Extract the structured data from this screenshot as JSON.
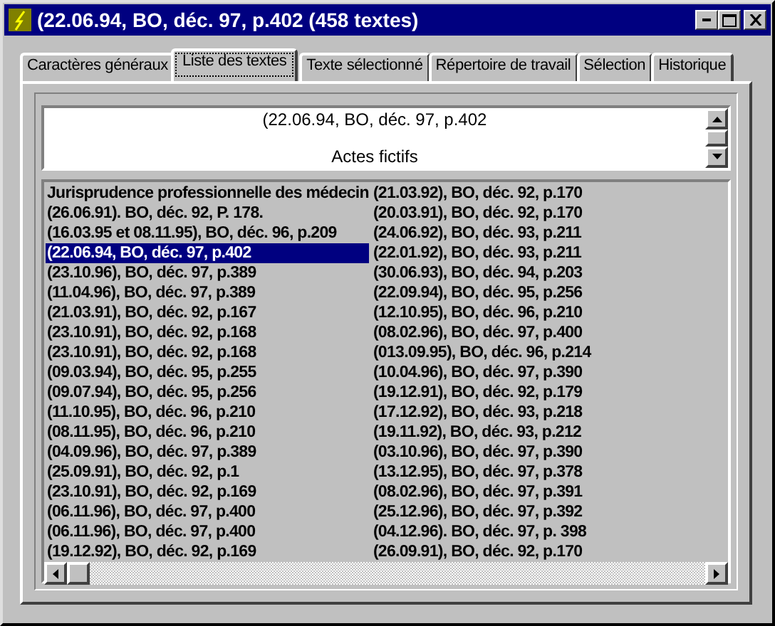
{
  "window": {
    "title": "(22.06.94, BO, déc. 97, p.402 (458 textes)"
  },
  "tabs": [
    {
      "label": "Caractères généraux",
      "selected": false
    },
    {
      "label": "Liste des textes",
      "selected": true
    },
    {
      "label": "Texte sélectionné",
      "selected": false
    },
    {
      "label": "Répertoire de travail",
      "selected": false
    },
    {
      "label": "Sélection",
      "selected": false
    },
    {
      "label": "Historique",
      "selected": false
    }
  ],
  "preview": {
    "lines": [
      "(22.06.94, BO, déc. 97, p.402",
      "Actes fictifs"
    ]
  },
  "list": {
    "items": [
      {
        "text": "Jurisprudence professionnelle des médecin",
        "selected": false
      },
      {
        "text": "(26.06.91). BO, déc. 92, P. 178.",
        "selected": false
      },
      {
        "text": "(16.03.95 et 08.11.95), BO, déc. 96, p.209",
        "selected": false
      },
      {
        "text": "(22.06.94, BO, déc. 97, p.402",
        "selected": true
      },
      {
        "text": "(23.10.96), BO, déc. 97, p.389",
        "selected": false
      },
      {
        "text": "(11.04.96), BO, déc. 97, p.389",
        "selected": false
      },
      {
        "text": "(21.03.91), BO, déc. 92, p.167",
        "selected": false
      },
      {
        "text": "(23.10.91), BO, déc. 92, p.168",
        "selected": false
      },
      {
        "text": "(23.10.91), BO, déc. 92, p.168",
        "selected": false
      },
      {
        "text": "(09.03.94), BO, déc. 95, p.255",
        "selected": false
      },
      {
        "text": "(09.07.94), BO, déc. 95, p.256",
        "selected": false
      },
      {
        "text": "(11.10.95), BO, déc. 96, p.210",
        "selected": false
      },
      {
        "text": "(08.11.95), BO, déc. 96, p.210",
        "selected": false
      },
      {
        "text": "(04.09.96), BO, déc. 97, p.389",
        "selected": false
      },
      {
        "text": "(25.09.91), BO, déc. 92, p.1",
        "selected": false
      },
      {
        "text": "(23.10.91), BO, déc. 92, p.169",
        "selected": false
      },
      {
        "text": "(06.11.96), BO, déc. 97, p.400",
        "selected": false
      },
      {
        "text": "(06.11.96), BO, déc. 97, p.400",
        "selected": false
      },
      {
        "text": "(19.12.92), BO, déc. 92, p.169",
        "selected": false
      },
      {
        "text": "(21.03.92), BO, déc. 92, p.170",
        "selected": false
      },
      {
        "text": "(20.03.91), BO, déc. 92, p.170",
        "selected": false
      },
      {
        "text": "(24.06.92), BO, déc. 93, p.211",
        "selected": false
      },
      {
        "text": "(22.01.92), BO, déc. 93, p.211",
        "selected": false
      },
      {
        "text": "(30.06.93), BO, déc. 94, p.203",
        "selected": false
      },
      {
        "text": "(22.09.94), BO, déc. 95, p.256",
        "selected": false
      },
      {
        "text": "(12.10.95), BO, déc. 96, p.210",
        "selected": false
      },
      {
        "text": "(08.02.96), BO, déc. 97, p.400",
        "selected": false
      },
      {
        "text": "(013.09.95), BO, déc. 96, p.214",
        "selected": false
      },
      {
        "text": "(10.04.96), BO, déc. 97, p.390",
        "selected": false
      },
      {
        "text": "(19.12.91), BO, déc. 92, p.179",
        "selected": false
      },
      {
        "text": "(17.12.92), BO, déc. 93, p.218",
        "selected": false
      },
      {
        "text": "(19.11.92), BO, déc. 93, p.212",
        "selected": false
      },
      {
        "text": "(03.10.96), BO, déc. 97, p.390",
        "selected": false
      },
      {
        "text": "(13.12.95), BO, déc. 97, p.378",
        "selected": false
      },
      {
        "text": "(08.02.96), BO, déc. 97, p.391",
        "selected": false
      },
      {
        "text": "(25.12.96), BO, déc. 97, p.392",
        "selected": false
      },
      {
        "text": "(04.12.96). BO, déc. 97, p. 398",
        "selected": false
      },
      {
        "text": "(26.09.91), BO, déc. 92, p.170",
        "selected": false
      }
    ]
  }
}
